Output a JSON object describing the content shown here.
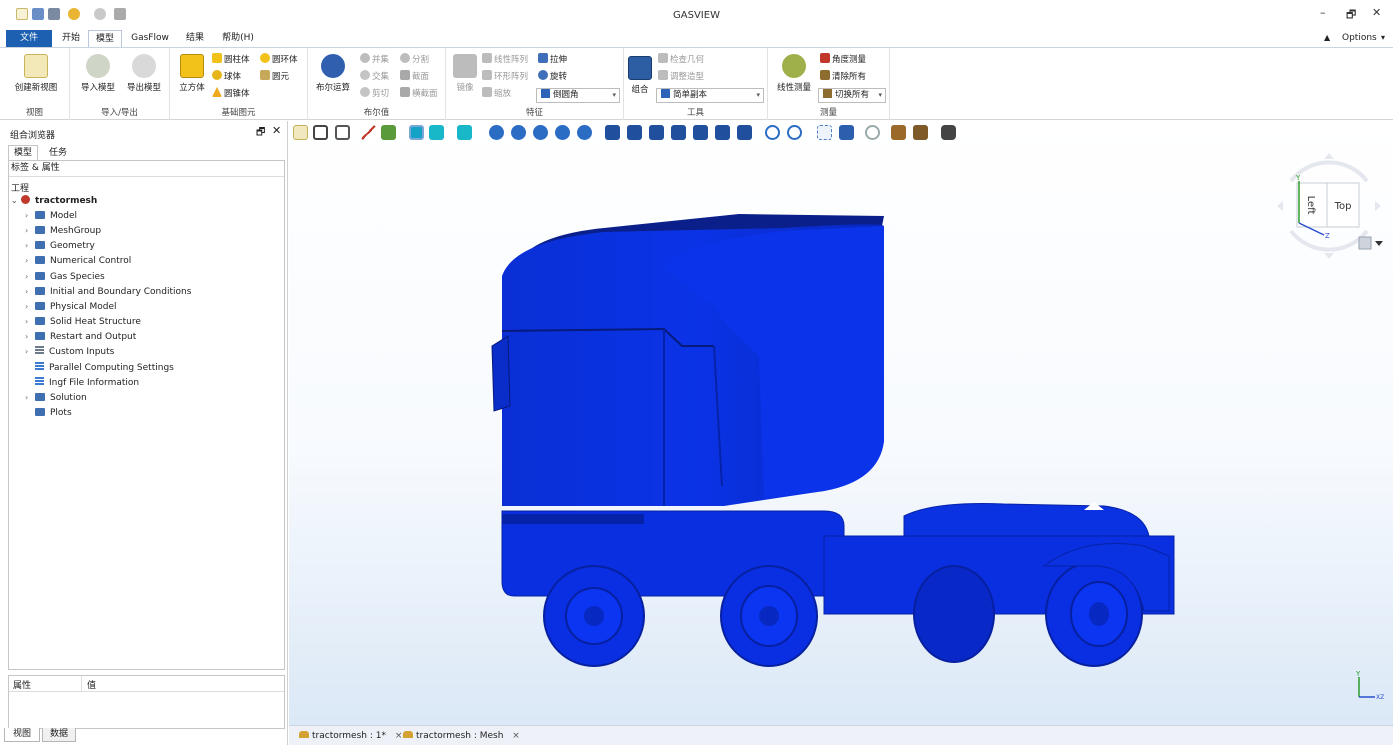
{
  "app": {
    "title": "GASVIEW",
    "options_label": "Options",
    "window_controls": {
      "minimize": "–",
      "restore": "🗗",
      "close": "✕"
    },
    "collapse_ribbon_icon": "▲"
  },
  "menu": {
    "tabs": [
      "文件",
      "开始",
      "模型",
      "GasFlow",
      "结果",
      "帮助(H)"
    ],
    "active": "模型"
  },
  "ribbon": {
    "groups": {
      "view": {
        "label": "视图",
        "create_view": "创建新视图"
      },
      "import_export": {
        "label": "导入/导出",
        "import": "导入模型",
        "export": "导出模型"
      },
      "primitives": {
        "label": "基础图元",
        "cube": "立方体",
        "cylinder": "圆柱体",
        "torus": "圆环体",
        "sphere": "球体",
        "circle": "圆元",
        "cone": "圆锥体"
      },
      "boolean": {
        "label": "布尔值",
        "boolean_op": "布尔运算",
        "union": "并集",
        "intersect": "交集",
        "cut": "剪切",
        "split": "分割",
        "section": "截面",
        "cross_section": "横截面"
      },
      "features": {
        "label": "特征",
        "mirror": "镜像",
        "linear_array": "线性阵列",
        "circular_array": "环形阵列",
        "scale": "缩放",
        "extrude": "拉伸",
        "revolve": "旋转",
        "chamfer_dropdown": "倒圆角"
      },
      "tools": {
        "label": "工具",
        "combine": "组合",
        "check_geometry": "检查几何",
        "adjust_shape": "调整造型",
        "simple_copy_dropdown": "简单副本"
      },
      "measure": {
        "label": "测量",
        "linear_measure": "线性测量",
        "angle_measure": "角度测量",
        "clear_all": "清除所有",
        "toggle_all_dropdown": "切换所有"
      }
    }
  },
  "browser": {
    "title": "组合浏览器",
    "tabs": [
      "模型",
      "任务"
    ],
    "section_header": "标签 & 属性",
    "project_label": "工程",
    "root": "tractormesh",
    "items": [
      {
        "label": "Model",
        "icon": "folder-icon",
        "expandable": true
      },
      {
        "label": "MeshGroup",
        "icon": "folder-icon",
        "expandable": true
      },
      {
        "label": "Geometry",
        "icon": "folder-icon",
        "expandable": true
      },
      {
        "label": "Numerical Control",
        "icon": "folder-icon",
        "expandable": true
      },
      {
        "label": "Gas Species",
        "icon": "folder-icon",
        "expandable": true
      },
      {
        "label": "Initial and Boundary Conditions",
        "icon": "folder-icon",
        "expandable": true
      },
      {
        "label": "Physical Model",
        "icon": "folder-icon",
        "expandable": true
      },
      {
        "label": "Solid Heat Structure",
        "icon": "folder-icon",
        "expandable": true
      },
      {
        "label": "Restart and Output",
        "icon": "folder-icon",
        "expandable": true
      },
      {
        "label": "Custom Inputs",
        "icon": "table-icon",
        "expandable": true
      },
      {
        "label": "Parallel Computing Settings",
        "icon": "list-icon",
        "expandable": false
      },
      {
        "label": "Ingf File Information",
        "icon": "list-icon",
        "expandable": false
      },
      {
        "label": "Solution",
        "icon": "folder-icon",
        "expandable": true
      },
      {
        "label": "Plots",
        "icon": "folder-icon",
        "expandable": false
      }
    ],
    "props_header": {
      "property": "属性",
      "value": "值"
    },
    "bottom_tabs": [
      "视图",
      "数据"
    ]
  },
  "viewport": {
    "navcube": {
      "face_front": "Left",
      "face_right": "Top",
      "axis_y": "Y",
      "axis_z": "Z"
    },
    "corner_axes": {
      "y": "Y",
      "xz": "XZ"
    },
    "model_color": "#0a2fe0"
  },
  "doc_tabs": [
    {
      "label": "tractormesh : 1*",
      "close": "×"
    },
    {
      "label": "tractormesh : Mesh",
      "close": "×"
    }
  ]
}
